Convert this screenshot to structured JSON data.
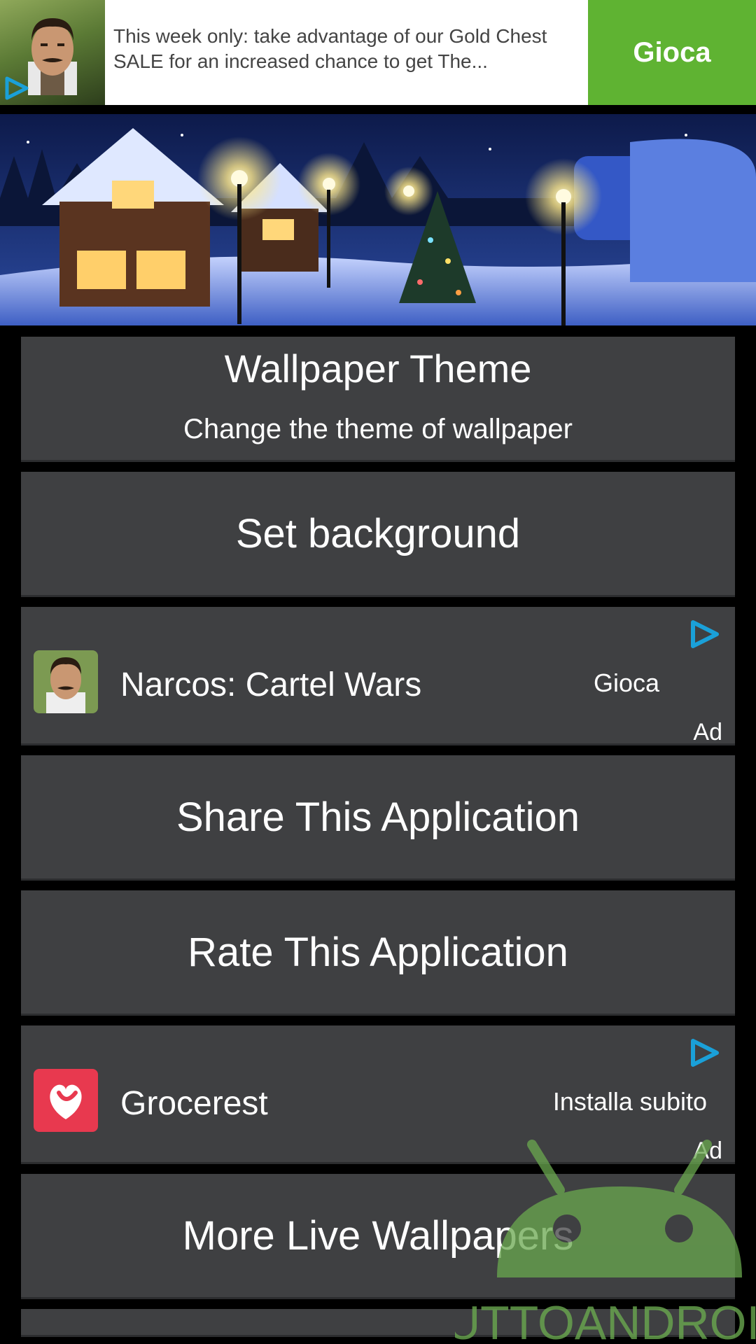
{
  "top_ad": {
    "text": "This week only: take advantage of our Gold Chest SALE for an increased chance to get The...",
    "cta": "Gioca"
  },
  "menu": {
    "wallpaper_theme": {
      "title": "Wallpaper Theme",
      "subtitle": "Change the theme of wallpaper"
    },
    "set_background": "Set background",
    "native_ad_1": {
      "title": "Narcos: Cartel Wars",
      "cta": "Gioca",
      "label": "Ad"
    },
    "share": "Share This Application",
    "rate": "Rate This Application",
    "native_ad_2": {
      "title": "Grocerest",
      "cta": "Installa subito",
      "label": "Ad"
    },
    "more": "More Live Wallpapers"
  },
  "watermark": {
    "text": "TUTTOANDROID"
  },
  "colors": {
    "row_bg": "#3f4042",
    "cta_green": "#5fb332",
    "ad_choice_blue": "#1aa0d8",
    "grocerest_red": "#e8394f",
    "watermark_green": "#6aa84f"
  },
  "icons": {
    "ad_choice": "play-triangle-icon",
    "header": "christmas-village-image"
  }
}
